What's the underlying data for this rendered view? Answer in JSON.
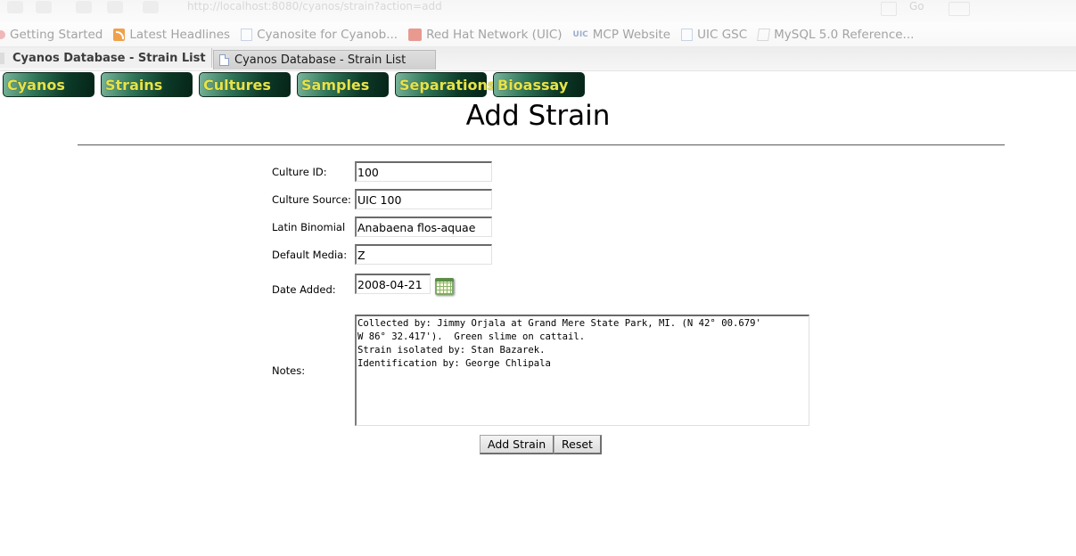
{
  "browser": {
    "url": "http://localhost:8080/cyanos/strain?action=add",
    "go_label": "Go",
    "bookmarks": [
      {
        "label": "Getting Started",
        "icon": "red-dot-icon"
      },
      {
        "label": "Latest Headlines",
        "icon": "rss-feed-icon"
      },
      {
        "label": "Cyanosite for Cyanob...",
        "icon": "page-icon"
      },
      {
        "label": "Red Hat Network (UIC)",
        "icon": "redhat-icon"
      },
      {
        "label": "MCP Website",
        "icon": "uic-logo-icon",
        "prefix": "UIC"
      },
      {
        "label": "UIC GSC",
        "icon": "page-icon"
      },
      {
        "label": "MySQL 5.0 Reference...",
        "icon": "mysql-doc-icon"
      }
    ],
    "tabs": [
      {
        "label": "Cyanos Database - Strain List",
        "active": true
      },
      {
        "label": "Cyanos Database - Strain List",
        "active": false
      }
    ]
  },
  "nav": {
    "items": [
      "Cyanos",
      "Strains",
      "Cultures",
      "Samples",
      "Separations",
      "Bioassay"
    ]
  },
  "page": {
    "title": "Add Strain"
  },
  "form": {
    "culture_id": {
      "label": "Culture ID:",
      "value": "100"
    },
    "culture_source": {
      "label": "Culture Source:",
      "value": "UIC 100"
    },
    "latin_binomial": {
      "label": "Latin Binomial",
      "value": "Anabaena flos-aquae"
    },
    "default_media": {
      "label": "Default Media:",
      "value": "Z"
    },
    "date_added": {
      "label": "Date Added:",
      "value": "2008-04-21"
    },
    "notes": {
      "label": "Notes:",
      "value": "Collected by: Jimmy Orjala at Grand Mere State Park, MI. (N 42° 00.679'\nW 86° 32.417').  Green slime on cattail.\nStrain isolated by: Stan Bazarek.\nIdentification by: George Chlipala"
    },
    "submit_label": "Add Strain",
    "reset_label": "Reset"
  }
}
